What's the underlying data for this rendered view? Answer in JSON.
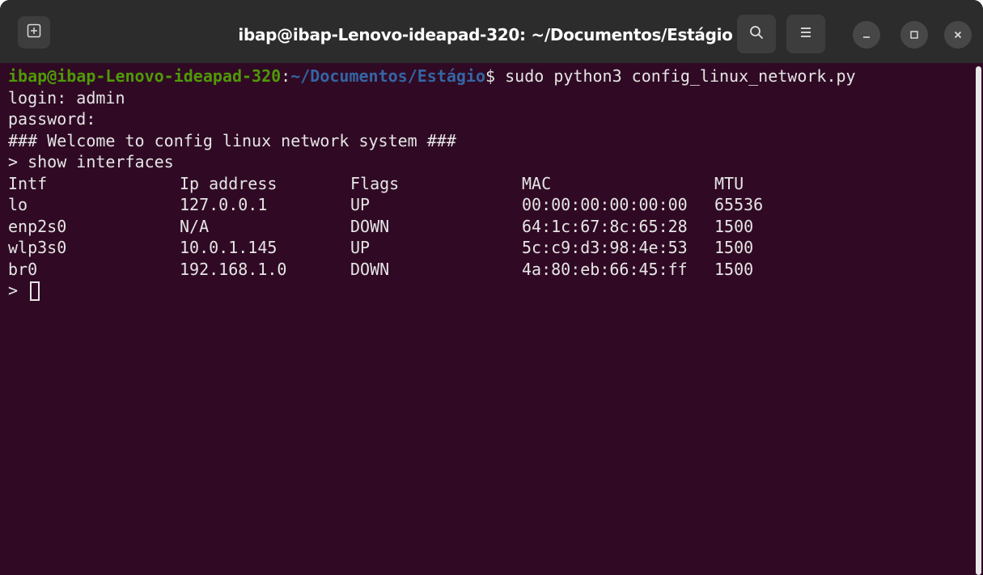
{
  "window": {
    "title": "ibap@ibap-Lenovo-ideapad-320: ~/Documentos/Estágio"
  },
  "titlebar_buttons": {
    "new_tab_icon": "new-tab-icon",
    "search_icon": "search-icon",
    "menu_icon": "hamburger-menu-icon",
    "minimize_icon": "minimize-icon",
    "maximize_icon": "maximize-icon",
    "close_icon": "close-icon"
  },
  "terminal": {
    "prompt_user": "ibap@ibap-Lenovo-ideapad-320",
    "prompt_sep": ":",
    "prompt_path": "~/Documentos/Estágio",
    "prompt_command": "$ sudo python3 config_linux_network.py",
    "lines": [
      "login: admin",
      "password:",
      "### Welcome to config linux network system ###",
      "> show interfaces"
    ],
    "table": {
      "headers": [
        "Intf",
        "Ip address",
        "Flags",
        "MAC",
        "MTU"
      ],
      "rows": [
        [
          "lo",
          "127.0.0.1",
          "UP",
          "00:00:00:00:00:00",
          "65536"
        ],
        [
          "enp2s0",
          "N/A",
          "DOWN",
          "64:1c:67:8c:65:28",
          "1500"
        ],
        [
          "wlp3s0",
          "10.0.1.145",
          "UP",
          "5c:c9:d3:98:4e:53",
          "1500"
        ],
        [
          "br0",
          "192.168.1.0",
          "DOWN",
          "4a:80:eb:66:45:ff",
          "1500"
        ]
      ]
    },
    "input_prompt": ">"
  },
  "colors": {
    "terminal_bg": "#300a24",
    "titlebar_bg": "#2c2c2c",
    "prompt_user": "#4e9a06",
    "prompt_path": "#3465a4",
    "text": "#e5e5e5"
  }
}
